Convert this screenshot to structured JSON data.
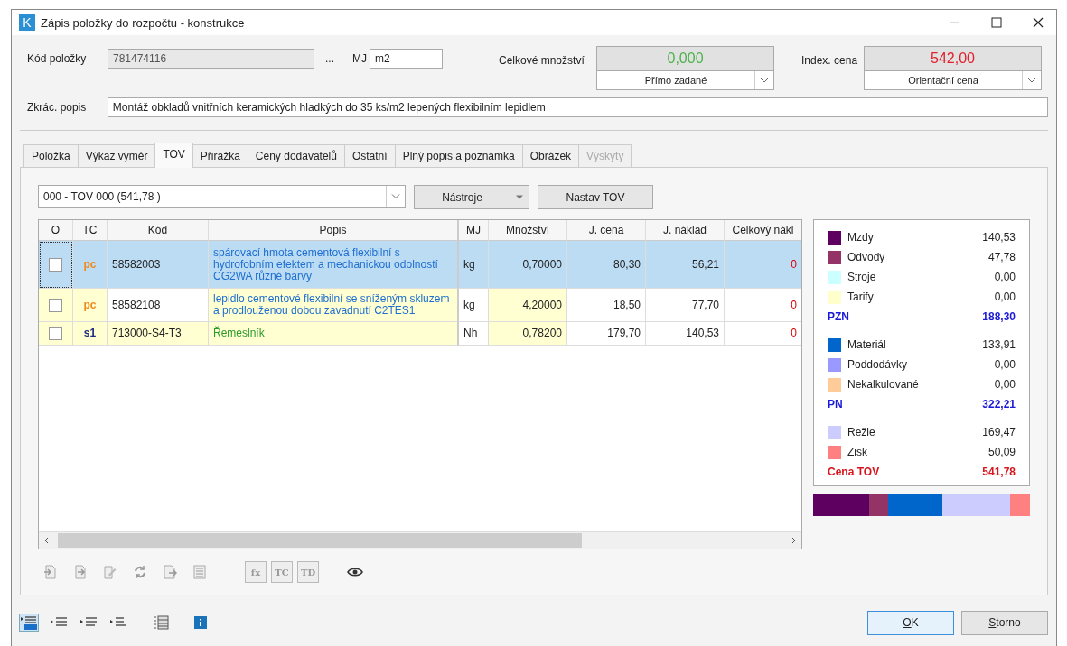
{
  "window": {
    "title": "Zápis položky do rozpočtu - konstrukce",
    "app_letter": "K"
  },
  "header": {
    "code_label": "Kód položky",
    "code": "781474116",
    "ellipsis": "...",
    "unit_label": "MJ",
    "unit": "m2",
    "qty_label": "Celkové množství",
    "qty": "0,000",
    "qty_mode": "Přímo zadané",
    "price_label": "Index. cena",
    "price": "542,00",
    "price_mode": "Orientační cena",
    "short_label": "Zkrác. popis",
    "short": "Montáž obkladů vnitřních keramických hladkých do 35 ks/m2 lepených flexibilním lepidlem"
  },
  "tabs": [
    {
      "label": "Položka",
      "selected": false,
      "disabled": false
    },
    {
      "label": "Výkaz výměr",
      "selected": false,
      "disabled": false
    },
    {
      "label": "TOV",
      "selected": true,
      "disabled": false
    },
    {
      "label": "Přirážka",
      "selected": false,
      "disabled": false
    },
    {
      "label": "Ceny dodavatelů",
      "selected": false,
      "disabled": false
    },
    {
      "label": "Ostatní",
      "selected": false,
      "disabled": false
    },
    {
      "label": "Plný popis a poznámka",
      "selected": false,
      "disabled": false
    },
    {
      "label": "Obrázek",
      "selected": false,
      "disabled": false
    },
    {
      "label": "Výskyty",
      "selected": false,
      "disabled": true
    }
  ],
  "tov_select": "000 - TOV 000 (541,78 )",
  "tools_button": "Nástroje",
  "set_button": "Nastav TOV",
  "table": {
    "columns": [
      "O",
      "TC",
      "Kód",
      "Popis",
      "MJ",
      "Množství",
      "J. cena",
      "J. náklad",
      "Celkový nákl"
    ],
    "rows": [
      {
        "checked": false,
        "selected": true,
        "kind": "pc",
        "tc": "pc",
        "code": "58582003",
        "desc": "spárovací hmota cementová flexibilní s hydrofobním efektem a mechanickou odolností CG2WA různé barvy",
        "unit": "kg",
        "qty": "0,70000",
        "unit_price": "80,30",
        "unit_cost": "56,21",
        "total": "0"
      },
      {
        "checked": false,
        "selected": false,
        "kind": "pc",
        "tc": "pc",
        "code": "58582108",
        "desc": "lepidlo cementové flexibilní se sníženým skluzem a prodlouženou dobou zavadnutí C2TES1",
        "unit": "kg",
        "qty": "4,20000",
        "unit_price": "18,50",
        "unit_cost": "77,70",
        "total": "0"
      },
      {
        "checked": false,
        "selected": false,
        "kind": "s1",
        "tc": "s1",
        "code": "713000-S4-T3",
        "desc": "Řemeslník",
        "unit": "Nh",
        "qty": "0,78200",
        "unit_price": "179,70",
        "unit_cost": "140,53",
        "total": "0"
      }
    ]
  },
  "table_tools": [
    "fx",
    "TC",
    "TD"
  ],
  "summary": [
    {
      "kind": "item",
      "label": "Mzdy",
      "value": "140,53",
      "color": "#5e0060"
    },
    {
      "kind": "item",
      "label": "Odvody",
      "value": "47,78",
      "color": "#943366"
    },
    {
      "kind": "item",
      "label": "Stroje",
      "value": "0,00",
      "color": "#ccffff"
    },
    {
      "kind": "item",
      "label": "Tarify",
      "value": "0,00",
      "color": "#ffffcc"
    },
    {
      "kind": "total",
      "label": "PZN",
      "value": "188,30"
    },
    {
      "kind": "item",
      "label": "Materiál",
      "value": "133,91",
      "color": "#0066cc"
    },
    {
      "kind": "item",
      "label": "Poddodávky",
      "value": "0,00",
      "color": "#9999ff"
    },
    {
      "kind": "item",
      "label": "Nekalkulované",
      "value": "0,00",
      "color": "#ffcc99"
    },
    {
      "kind": "total",
      "label": "PN",
      "value": "322,21"
    },
    {
      "kind": "item",
      "label": "Režie",
      "value": "169,47",
      "color": "#ccccff"
    },
    {
      "kind": "item",
      "label": "Zisk",
      "value": "50,09",
      "color": "#ff8080"
    },
    {
      "kind": "grand",
      "label": "Cena TOV",
      "value": "541,78"
    }
  ],
  "buttons": [
    {
      "label": "OK",
      "default": true
    },
    {
      "label": "Storno",
      "default": false
    }
  ]
}
